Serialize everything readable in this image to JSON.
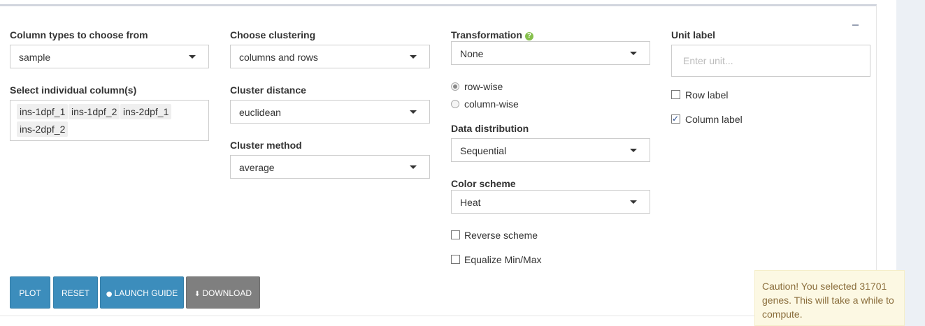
{
  "column_types": {
    "label": "Column types to choose from",
    "value": "sample"
  },
  "individual_columns": {
    "label": "Select individual column(s)",
    "tags": [
      "ins-1dpf_1",
      "ins-1dpf_2",
      "ins-2dpf_1",
      "ins-2dpf_2"
    ]
  },
  "clustering": {
    "label": "Choose clustering",
    "value": "columns and rows"
  },
  "cluster_distance": {
    "label": "Cluster distance",
    "value": "euclidean"
  },
  "cluster_method": {
    "label": "Cluster method",
    "value": "average"
  },
  "transformation": {
    "label": "Transformation",
    "help_icon": "question-circle-icon",
    "value": "None",
    "options": [
      {
        "label": "row-wise",
        "selected": true
      },
      {
        "label": "column-wise",
        "selected": false
      }
    ]
  },
  "data_distribution": {
    "label": "Data distribution",
    "value": "Sequential"
  },
  "color_scheme": {
    "label": "Color scheme",
    "value": "Heat"
  },
  "reverse_scheme": {
    "label": "Reverse scheme",
    "checked": false
  },
  "equalize": {
    "label": "Equalize Min/Max",
    "checked": false
  },
  "unit_label": {
    "label": "Unit label",
    "placeholder": "Enter unit...",
    "value": ""
  },
  "row_label": {
    "label": "Row label",
    "checked": false
  },
  "column_label": {
    "label": "Column label",
    "checked": true
  },
  "buttons": {
    "plot": "PLOT",
    "reset": "RESET",
    "launch_guide": "LAUNCH GUIDE",
    "download": "DOWNLOAD"
  },
  "notification": {
    "text": "Caution! You selected 31701 genes. This will take a while to compute."
  },
  "colors": {
    "primary_button": "#3c8dbc",
    "download_button": "#7f7f7f",
    "help_icon": "#86c04c",
    "warning_bg": "#fcf8e3",
    "warning_text": "#8a6d3b"
  }
}
